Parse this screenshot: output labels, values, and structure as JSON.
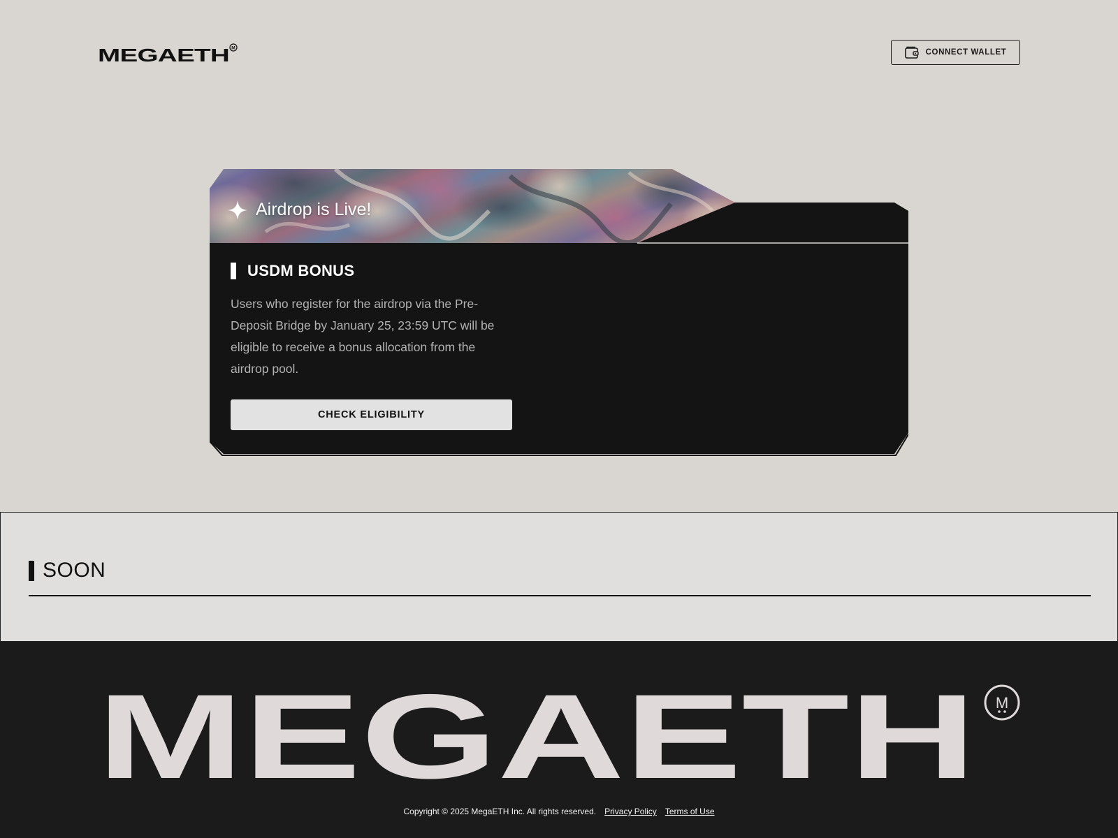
{
  "header": {
    "logo_text": "MEGAETH",
    "connect_wallet_label": "CONNECT WALLET"
  },
  "card": {
    "banner_title": "Airdrop is Live!",
    "section_title": "USDM BONUS",
    "description": "Users who register for the airdrop via the Pre-Deposit Bridge by January 25, 23:59 UTC will be eligible to receive a bonus allocation from the airdrop pool.",
    "check_button_label": "CHECK ELIGIBILITY"
  },
  "soon": {
    "title": "SOON"
  },
  "footer": {
    "logo_text": "MEGAETH",
    "copyright": "Copyright © 2025 MegaETH Inc. All rights reserved.",
    "privacy_label": "Privacy Policy",
    "terms_label": "Terms of Use"
  },
  "colors": {
    "page_bg": "#d9d6d1",
    "card_bg": "#141414",
    "button_bg": "#e2e2e2",
    "soon_bg": "#e0dfdd",
    "footer_bg": "#1b1b1b",
    "footer_logo": "#dfd9da"
  },
  "icons": [
    "wallet-icon",
    "sparkle-star-icon",
    "trademark-m-icon"
  ]
}
